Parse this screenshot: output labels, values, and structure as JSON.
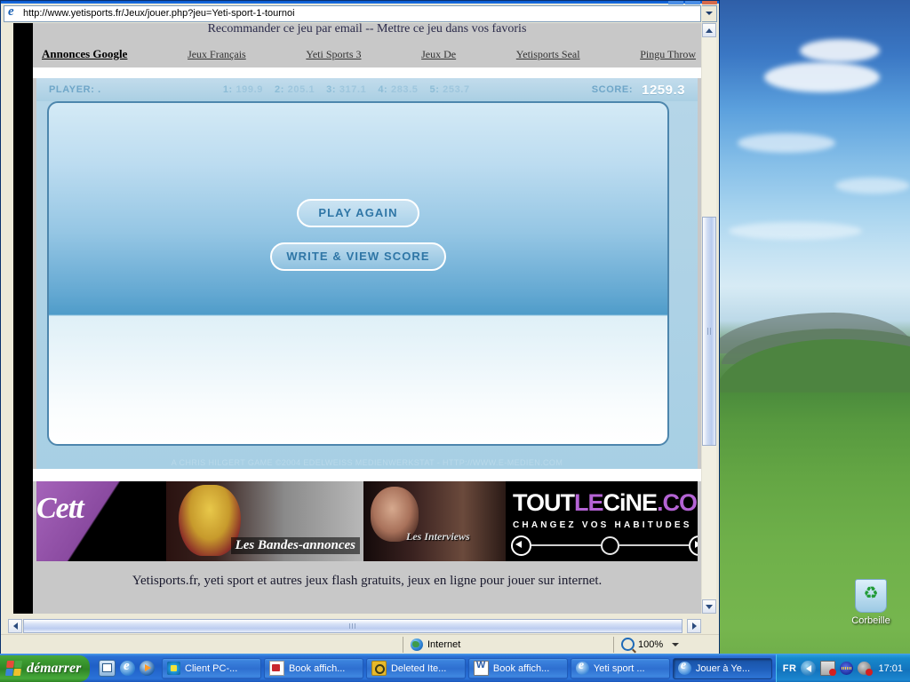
{
  "browser": {
    "address_url": "http://www.yetisports.fr/Jeux/jouer.php?jeu=Yeti-sport-1-tournoi",
    "status_text": "",
    "zone_label": "Internet",
    "zoom_label": "100%"
  },
  "page": {
    "recommend_bar": "Recommander ce jeu par email -- Mettre ce jeu dans vos favoris",
    "ads": {
      "heading": "Annonces Google",
      "links": [
        "Jeux Français",
        "Yeti Sports 3",
        "Jeux De",
        "Yetisports Seal",
        "Pingu Throw"
      ]
    },
    "footer_text": "Yetisports.fr, yeti sport et autres jeux flash gratuits, jeux en ligne pour jouer sur internet."
  },
  "game": {
    "scorebar": {
      "player_label": "PLAYER:",
      "player_name": ".",
      "throws": [
        {
          "num": "1:",
          "value": "199.9"
        },
        {
          "num": "2:",
          "value": "205.1"
        },
        {
          "num": "3:",
          "value": "317.1"
        },
        {
          "num": "4:",
          "value": "283.5"
        },
        {
          "num": "5:",
          "value": "253.7"
        }
      ],
      "score_label": "SCORE:",
      "score_value": "1259.3"
    },
    "buttons": {
      "play_again": "PLAY AGAIN",
      "write_view_score": "WRITE & VIEW SCORE"
    },
    "credit": "A CHRIS HILGERT GAME  ©2004 EDELWEISS MEDIENWERKSTAT - HTTP://WWW.E-MEDIEN.COM"
  },
  "banner": {
    "left_text": "Cett",
    "caption_trailers": "Les Bandes-annonces",
    "caption_interviews": "Les Interviews",
    "logo": {
      "part1": "TOUT",
      "part2": "LE",
      "part3": "CiNE",
      "part4": ".COM"
    },
    "tagline": "CHANGEZ VOS HABITUDES"
  },
  "desktop": {
    "recycle_bin_label": "Corbeille"
  },
  "taskbar": {
    "start_label": "démarrer",
    "quicklaunch": [
      "show-desktop-icon",
      "internet-explorer-icon",
      "windows-media-player-icon"
    ],
    "tasks": [
      {
        "label": "Client PC-...",
        "icon": "client",
        "active": false
      },
      {
        "label": "Book affich...",
        "icon": "pdf",
        "active": false
      },
      {
        "label": "Deleted Ite...",
        "icon": "outlook",
        "active": false
      },
      {
        "label": "Book affich...",
        "icon": "word",
        "active": false
      },
      {
        "label": "Yeti sport ...",
        "icon": "ie",
        "active": false
      },
      {
        "label": "Jouer à Ye...",
        "icon": "ie",
        "active": true
      }
    ],
    "tray": {
      "language": "FR",
      "clock": "17:01"
    }
  },
  "colors": {
    "taskbar_blue": "#1f5fc6",
    "start_green": "#2f8526",
    "game_sky": "#95c6e4",
    "accent_purple": "#b463d4"
  }
}
